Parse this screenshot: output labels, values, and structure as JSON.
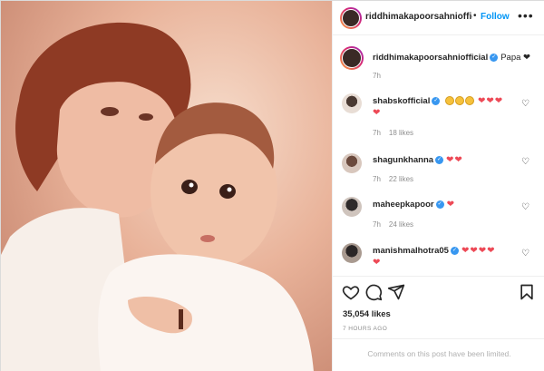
{
  "header": {
    "username": "riddhimakapoorsahniofficial",
    "separator": "•",
    "follow_label": "Follow",
    "more_label": "•••"
  },
  "caption": {
    "username": "riddhimakapoorsahniofficial",
    "text": "Papa ❤",
    "time": "7h"
  },
  "comments": [
    {
      "username": "shabskofficial",
      "text": "❤❤❤",
      "text2": "❤",
      "time": "7h",
      "likes": "18 likes",
      "yellow_emojis": 3
    },
    {
      "username": "shagunkhanna",
      "text": "❤❤",
      "time": "7h",
      "likes": "22 likes"
    },
    {
      "username": "maheepkapoor",
      "text": "❤",
      "time": "7h",
      "likes": "24 likes"
    },
    {
      "username": "manishmalhotra05",
      "text": "❤❤❤❤",
      "text2": "❤",
      "time": "",
      "likes": ""
    }
  ],
  "post": {
    "likes": "35,054 likes",
    "ago": "7 HOURS AGO",
    "comments_limited": "Comments on this post have been limited."
  },
  "colors": {
    "accent": "#0095f6",
    "heart": "#ed4956",
    "muted": "#8e8e8e",
    "verified": "#3897f0"
  }
}
